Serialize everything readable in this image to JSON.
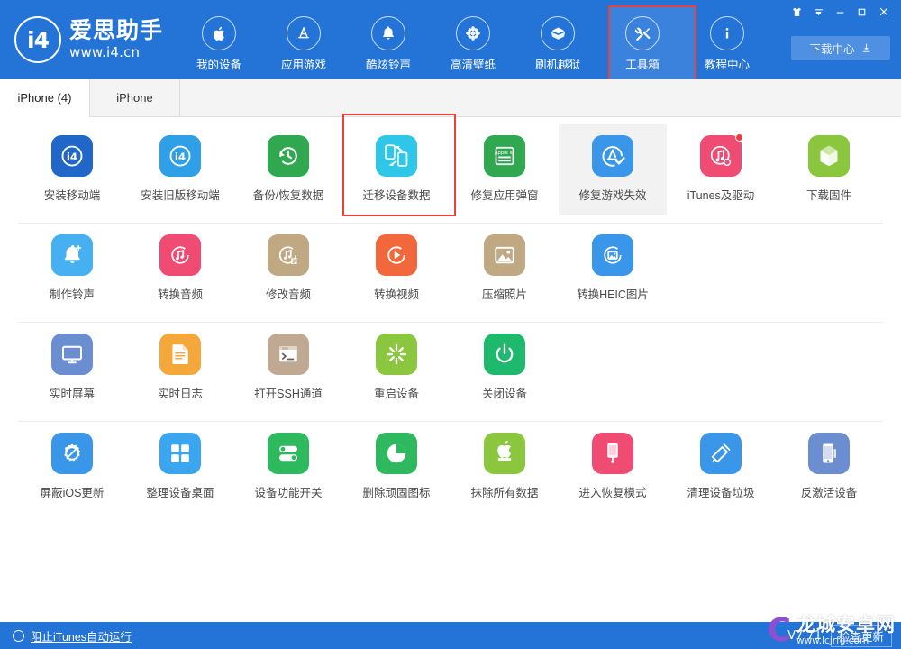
{
  "app": {
    "logo_cn": "爱思助手",
    "logo_url": "www.i4.cn",
    "logo_mark": "i4",
    "version": "V7.71",
    "accent_blue": "#2474d8",
    "highlight_red": "#e8423a"
  },
  "header": {
    "nav": [
      {
        "label": "我的设备",
        "icon": "apple-icon",
        "active": false
      },
      {
        "label": "应用游戏",
        "icon": "appstore-icon",
        "active": false
      },
      {
        "label": "酷炫铃声",
        "icon": "bell-icon",
        "active": false
      },
      {
        "label": "高清壁纸",
        "icon": "flower-icon",
        "active": false
      },
      {
        "label": "刷机越狱",
        "icon": "box-open-icon",
        "active": false
      },
      {
        "label": "工具箱",
        "icon": "tools-icon",
        "active": true
      },
      {
        "label": "教程中心",
        "icon": "info-icon",
        "active": false
      }
    ],
    "download_center": "下载中心",
    "window_controls": [
      {
        "name": "skin-icon",
        "glyph": "👕"
      },
      {
        "name": "menu-dropdown-icon",
        "glyph": "▼"
      },
      {
        "name": "minimize-icon",
        "glyph": "—"
      },
      {
        "name": "maximize-icon",
        "glyph": "▢"
      },
      {
        "name": "close-icon",
        "glyph": "✕"
      }
    ]
  },
  "tabs": [
    {
      "label": "iPhone (4)",
      "active": true
    },
    {
      "label": "iPhone",
      "active": false
    }
  ],
  "tool_rows": [
    [
      {
        "label": "安装移动端",
        "icon": "i4-app-icon",
        "bg": "#2067c9",
        "hover": false,
        "boxed": false,
        "badge": false
      },
      {
        "label": "安装旧版移动端",
        "icon": "i4-app-legacy-icon",
        "bg": "#2f9fe8",
        "hover": false,
        "boxed": false,
        "badge": false
      },
      {
        "label": "备份/恢复数据",
        "icon": "restore-clock-icon",
        "bg": "#2fa84f",
        "hover": false,
        "boxed": false,
        "badge": false
      },
      {
        "label": "迁移设备数据",
        "icon": "migrate-phones-icon",
        "bg": "#2ec7ea",
        "hover": false,
        "boxed": true,
        "badge": false
      },
      {
        "label": "修复应用弹窗",
        "icon": "appleid-card-icon",
        "bg": "#2fa84f",
        "hover": false,
        "boxed": false,
        "badge": false
      },
      {
        "label": "修复游戏失效",
        "icon": "appstore-check-icon",
        "bg": "#3a96e8",
        "hover": true,
        "boxed": false,
        "badge": false
      },
      {
        "label": "iTunes及驱动",
        "icon": "itunes-icon",
        "bg": "#ef4b73",
        "hover": false,
        "boxed": false,
        "badge": true
      },
      {
        "label": "下载固件",
        "icon": "cube-icon",
        "bg": "#8bc63f",
        "hover": false,
        "boxed": false,
        "badge": false
      }
    ],
    [
      {
        "label": "制作铃声",
        "icon": "bell-plus-icon",
        "bg": "#46b0f0",
        "hover": false,
        "boxed": false,
        "badge": false
      },
      {
        "label": "转换音频",
        "icon": "music-convert-icon",
        "bg": "#ef4b73",
        "hover": false,
        "boxed": false,
        "badge": false
      },
      {
        "label": "修改音频",
        "icon": "music-edit-icon",
        "bg": "#c0a982",
        "hover": false,
        "boxed": false,
        "badge": false
      },
      {
        "label": "转换视频",
        "icon": "video-play-icon",
        "bg": "#f2683c",
        "hover": false,
        "boxed": false,
        "badge": false
      },
      {
        "label": "压缩照片",
        "icon": "image-compress-icon",
        "bg": "#c0a982",
        "hover": false,
        "boxed": false,
        "badge": false
      },
      {
        "label": "转换HEIC图片",
        "icon": "image-convert-icon",
        "bg": "#3a96e8",
        "hover": false,
        "boxed": false,
        "badge": false
      }
    ],
    [
      {
        "label": "实时屏幕",
        "icon": "monitor-icon",
        "bg": "#6b8ed0",
        "hover": false,
        "boxed": false,
        "badge": false
      },
      {
        "label": "实时日志",
        "icon": "log-document-icon",
        "bg": "#f4a83a",
        "hover": false,
        "boxed": false,
        "badge": false
      },
      {
        "label": "打开SSH通道",
        "icon": "terminal-icon",
        "bg": "#c0a992",
        "hover": false,
        "boxed": false,
        "badge": false
      },
      {
        "label": "重启设备",
        "icon": "restart-burst-icon",
        "bg": "#8bc63f",
        "hover": false,
        "boxed": false,
        "badge": false
      },
      {
        "label": "关闭设备",
        "icon": "power-icon",
        "bg": "#1fb96e",
        "hover": false,
        "boxed": false,
        "badge": false
      }
    ],
    [
      {
        "label": "屏蔽iOS更新",
        "icon": "block-gear-icon",
        "bg": "#3a96e8",
        "hover": false,
        "boxed": false,
        "badge": false
      },
      {
        "label": "整理设备桌面",
        "icon": "grid-squares-icon",
        "bg": "#3aa6ef",
        "hover": false,
        "boxed": false,
        "badge": false
      },
      {
        "label": "设备功能开关",
        "icon": "toggles-icon",
        "bg": "#2fb95e",
        "hover": false,
        "boxed": false,
        "badge": false
      },
      {
        "label": "删除顽固图标",
        "icon": "pie-clock-icon",
        "bg": "#2fb95e",
        "hover": false,
        "boxed": false,
        "badge": false
      },
      {
        "label": "抹除所有数据",
        "icon": "apple-erase-icon",
        "bg": "#8bc63f",
        "hover": false,
        "boxed": false,
        "badge": false
      },
      {
        "label": "进入恢复模式",
        "icon": "phone-cable-icon",
        "bg": "#ef4b73",
        "hover": false,
        "boxed": false,
        "badge": false
      },
      {
        "label": "清理设备垃圾",
        "icon": "broom-clean-icon",
        "bg": "#3a96e8",
        "hover": false,
        "boxed": false,
        "badge": false
      },
      {
        "label": "反激活设备",
        "icon": "phone-deactivate-icon",
        "bg": "#6b8ed0",
        "hover": false,
        "boxed": false,
        "badge": false
      }
    ]
  ],
  "statusbar": {
    "block_itunes": "阻止iTunes自动运行",
    "version": "V7.71",
    "check_label": "检查更新"
  },
  "watermark": {
    "letter": "C",
    "name": "龙城安卓网",
    "url": "www.lcjrfg.com"
  }
}
